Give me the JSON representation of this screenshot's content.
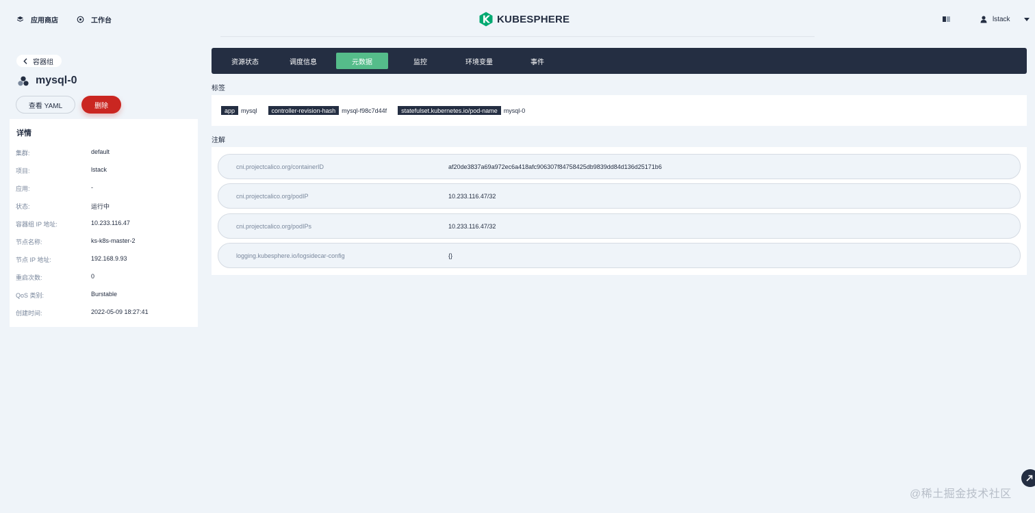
{
  "header": {
    "nav": [
      {
        "label": "应用商店",
        "icon": "app-store-icon"
      },
      {
        "label": "工作台",
        "icon": "workbench-icon"
      }
    ],
    "logo_text": "KUBESPHERE",
    "user": "lstack"
  },
  "sidebar": {
    "back_label": "容器组",
    "pod_name": "mysql-0",
    "yaml_button": "查看 YAML",
    "delete_button": "删除",
    "details_title": "详情",
    "details": [
      {
        "key": "集群:",
        "value": "default"
      },
      {
        "key": "项目:",
        "value": "lstack"
      },
      {
        "key": "应用:",
        "value": "-"
      },
      {
        "key": "状态:",
        "value": "运行中"
      },
      {
        "key": "容器组 IP 地址:",
        "value": "10.233.116.47"
      },
      {
        "key": "节点名称:",
        "value": "ks-k8s-master-2"
      },
      {
        "key": "节点 IP 地址:",
        "value": "192.168.9.93"
      },
      {
        "key": "重启次数:",
        "value": "0"
      },
      {
        "key": "QoS 类别:",
        "value": "Burstable"
      },
      {
        "key": "创建时间:",
        "value": "2022-05-09 18:27:41"
      }
    ]
  },
  "tabs": [
    {
      "label": "资源状态",
      "active": false
    },
    {
      "label": "调度信息",
      "active": false
    },
    {
      "label": "元数据",
      "active": true
    },
    {
      "label": "监控",
      "active": false
    },
    {
      "label": "环境变量",
      "active": false
    },
    {
      "label": "事件",
      "active": false
    }
  ],
  "labels_section": {
    "title": "标签",
    "items": [
      {
        "key": "app",
        "value": "mysql"
      },
      {
        "key": "controller-revision-hash",
        "value": "mysql-f98c7d44f"
      },
      {
        "key": "statefulset.kubernetes.io/pod-name",
        "value": "mysql-0"
      }
    ]
  },
  "annotations_section": {
    "title": "注解",
    "items": [
      {
        "key": "cni.projectcalico.org/containerID",
        "value": "af20de3837a69a972ec6a418afc906307f84758425db9839dd84d136d25171b6"
      },
      {
        "key": "cni.projectcalico.org/podIP",
        "value": "10.233.116.47/32"
      },
      {
        "key": "cni.projectcalico.org/podIPs",
        "value": "10.233.116.47/32"
      },
      {
        "key": "logging.kubesphere.io/logsidecar-config",
        "value": "{}"
      }
    ]
  },
  "watermark": "@稀土掘金技术社区",
  "colors": {
    "dark": "#242e42",
    "accent_green": "#55bc8a",
    "danger": "#ca2621",
    "background": "#eff4f9"
  }
}
